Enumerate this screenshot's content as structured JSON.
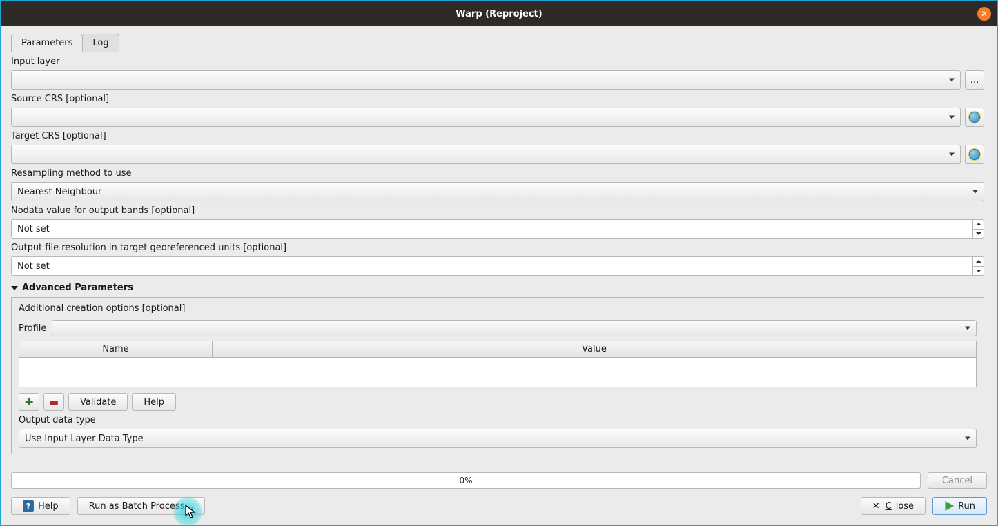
{
  "window": {
    "title": "Warp (Reproject)"
  },
  "tabs": {
    "parameters": "Parameters",
    "log": "Log"
  },
  "labels": {
    "input_layer": "Input layer",
    "source_crs": "Source CRS [optional]",
    "target_crs": "Target CRS [optional]",
    "resampling": "Resampling method to use",
    "nodata": "Nodata value for output bands [optional]",
    "resolution": "Output file resolution in target georeferenced units [optional]",
    "advanced": "Advanced Parameters",
    "additional": "Additional creation options [optional]",
    "profile": "Profile",
    "name_col": "Name",
    "value_col": "Value",
    "output_type": "Output data type"
  },
  "values": {
    "input_layer": "",
    "source_crs": "",
    "target_crs": "",
    "resampling": "Nearest Neighbour",
    "nodata": "Not set",
    "resolution": "Not set",
    "profile": "",
    "output_type": "Use Input Layer Data Type"
  },
  "buttons": {
    "browse": "…",
    "validate": "Validate",
    "help_opt": "Help",
    "cancel": "Cancel",
    "help": "Help",
    "batch": "Run as Batch Process…",
    "close": "Close",
    "run": "Run"
  },
  "progress": {
    "text": "0%"
  }
}
